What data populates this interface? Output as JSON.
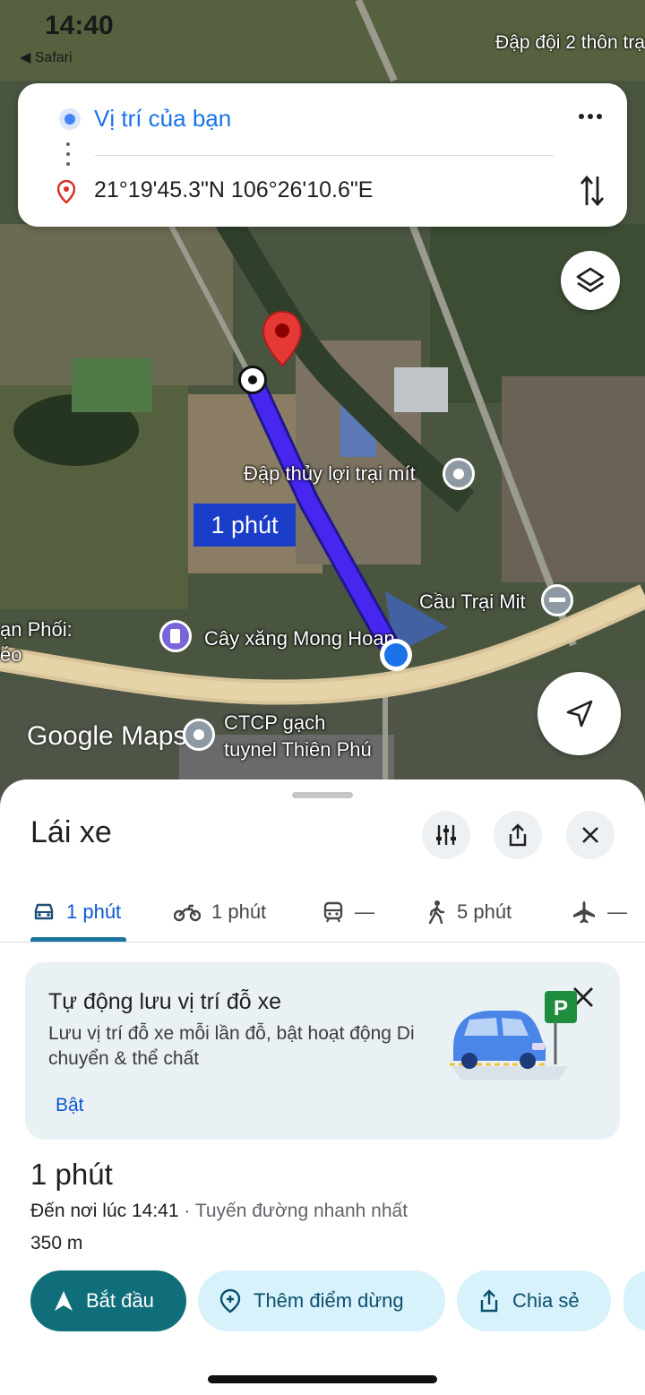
{
  "status_bar": {
    "time": "14:40",
    "back_app": "◀ Safari",
    "place_label": "Đập đội 2 thôn trạ"
  },
  "directions": {
    "origin": "Vị trí của bạn",
    "destination": "21°19'45.3\"N 106°26'10.6\"E"
  },
  "map": {
    "route_duration_badge": "1 phút",
    "labels": {
      "dam": "Đập thủy lợi trại mít",
      "bridge": "Cầu Trại Mit",
      "gas": "Cây xăng Mong Hoan",
      "company_line1": "CTCP gạch",
      "company_line2": "tuynel Thiên Phú",
      "left_edge_1": "ạn Phối:",
      "left_edge_2": "éo"
    },
    "logo": "Google Maps"
  },
  "sheet": {
    "title": "Lái xe",
    "tabs": [
      {
        "icon": "car-icon",
        "label": "1 phút"
      },
      {
        "icon": "motorbike-icon",
        "label": "1 phút"
      },
      {
        "icon": "transit-icon",
        "label": "—"
      },
      {
        "icon": "walk-icon",
        "label": "5 phút"
      },
      {
        "icon": "plane-icon",
        "label": "—"
      }
    ],
    "promo": {
      "title": "Tự động lưu vị trí đỗ xe",
      "body": "Lưu vị trí đỗ xe mỗi lần đỗ, bật hoạt động Di chuyển & thể chất",
      "link": "Bật",
      "parking_sign": "P"
    },
    "eta": "1 phút",
    "arrival_prefix": "Đến nơi lúc 14:41",
    "arrival_sub": " · Tuyến đường nhanh nhất",
    "distance": "350 m",
    "actions": {
      "start": "Bắt đầu",
      "add_stop": "Thêm điểm dừng",
      "share": "Chia sẻ"
    }
  },
  "colors": {
    "accent": "#106e7a",
    "route": "#3b1ee0",
    "link": "#0b57d0"
  }
}
